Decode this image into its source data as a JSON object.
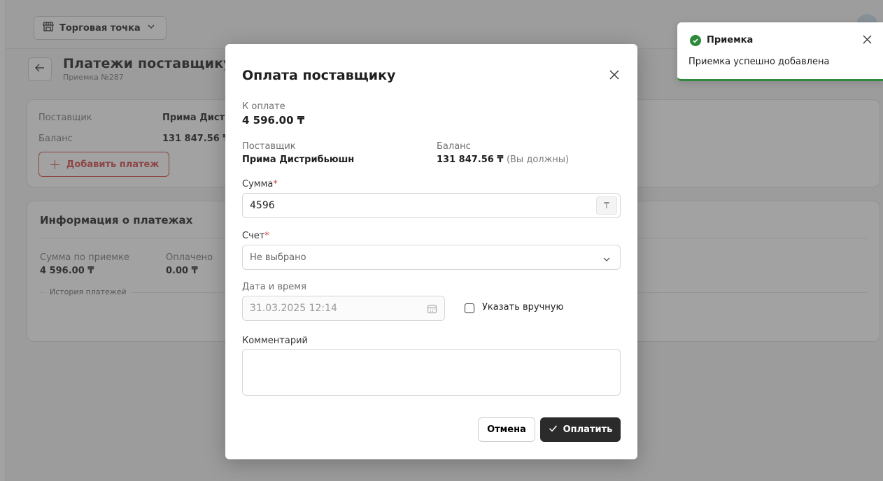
{
  "header": {
    "outlet_label": "Торговая точка"
  },
  "page": {
    "title": "Платежи поставщику",
    "subtitle": "Приемка №287",
    "supplier_label": "Поставщик",
    "supplier_value": "Прима Дистрибьюшн",
    "balance_label": "Баланс",
    "balance_value": "131 847.56 ₸",
    "add_payment_label": "Добавить платеж",
    "info_title": "Информация о платежах",
    "sum_label": "Сумма по приемке",
    "sum_value": "4 596.00 ₸",
    "paid_label": "Оплачено",
    "paid_value": "0.00 ₸",
    "history_label": "История платежей"
  },
  "modal": {
    "title": "Оплата поставщику",
    "to_pay_label": "К оплате",
    "to_pay_value": "4 596.00 ₸",
    "supplier_label": "Поставщик",
    "supplier_value": "Прима Дистрибьюшн",
    "balance_label": "Баланс",
    "balance_value": "131 847.56 ₸",
    "balance_note": "(Вы должны)",
    "amount_label": "Сумма",
    "amount_value": "4596",
    "currency_symbol": "₸",
    "account_label": "Счет",
    "account_value": "Не выбрано",
    "datetime_label": "Дата и время",
    "datetime_value": "31.03.2025 12:14",
    "manual_label": "Указать вручную",
    "comment_label": "Комментарий",
    "cancel_label": "Отмена",
    "pay_label": "Оплатить"
  },
  "toast": {
    "title": "Приемка",
    "message": "Приемка успешно добавлена",
    "accent_color": "#2f8a3c"
  },
  "colors": {
    "danger": "#d64545",
    "primary_dark": "#2b2b2b"
  }
}
